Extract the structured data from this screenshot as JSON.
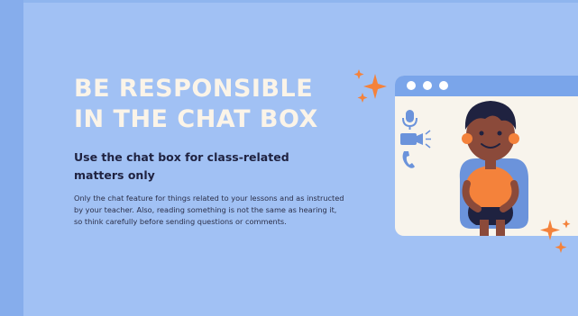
{
  "slide": {
    "title_line1": "BE RESPONSIBLE",
    "title_line2": "IN THE CHAT BOX",
    "subheading": "Use the chat box for class-related matters only",
    "body": "Only the chat feature for things related to your lessons and as instructed by your teacher. Also, reading something is not the same as hearing it, so think carefully before sending questions or comments."
  },
  "illustration": {
    "icons": [
      "microphone-icon",
      "camera-icon",
      "phone-icon"
    ],
    "window_dots": 3
  },
  "colors": {
    "background": "#a1c1f4",
    "band": "#86adec",
    "title": "#fbf4e8",
    "text": "#1f2240",
    "window_bar": "#7aa5ea",
    "window_body": "#f8f4ec",
    "accent_orange": "#f4823b",
    "icon_blue": "#6b93db"
  }
}
